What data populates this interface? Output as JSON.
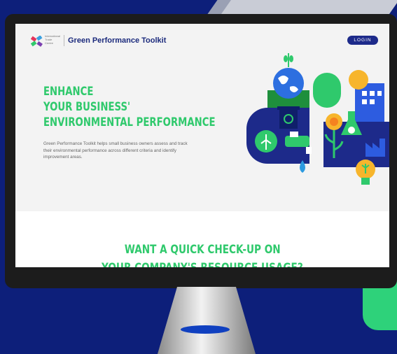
{
  "nav": {
    "org_lines": [
      "International",
      "Trade",
      "Centre"
    ],
    "title": "Green Performance Toolkit",
    "login_label": "LOGIN"
  },
  "hero": {
    "heading_lines": [
      "ENHANCE",
      "YOUR BUSINESS'",
      "ENVIRONMENTAL PERFORMANCE"
    ],
    "description": "Green Performance Toolkit helps small business owners assess and track their environmental performance across different criteria and identify improvement areas."
  },
  "cta": {
    "heading_lines": [
      "WANT A QUICK CHECK-UP ON",
      "YOUR COMPANY'S RESOURCE USAGE?"
    ]
  },
  "colors": {
    "accent_green": "#2fc96c",
    "brand_navy": "#1b2a7c",
    "background_blue": "#0d1f7a"
  },
  "icons": [
    "globe-icon",
    "recycle-bin-icon",
    "wind-turbine-icon",
    "water-tap-icon",
    "water-drop-icon",
    "flower-icon",
    "flask-icon",
    "factory-icon",
    "building-icon",
    "lightbulb-icon",
    "wheat-icon"
  ]
}
